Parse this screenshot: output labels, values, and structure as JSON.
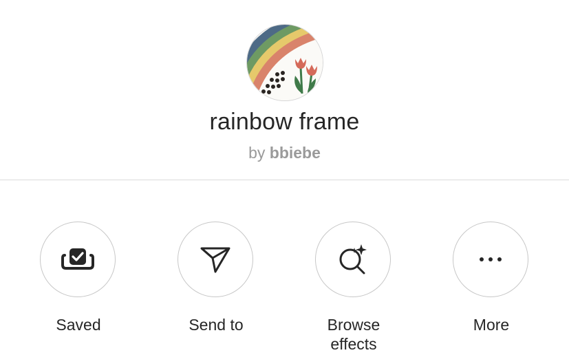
{
  "effect": {
    "name": "rainbow frame",
    "by_prefix": "by",
    "author": "bbiebe",
    "thumbnail_icon": "rainbow-tulip-thumbnail"
  },
  "actions": [
    {
      "label": "Saved",
      "icon": "saved-check-icon"
    },
    {
      "label": "Send to",
      "icon": "paper-plane-icon"
    },
    {
      "label": "Browse effects",
      "icon": "sparkle-search-icon"
    },
    {
      "label": "More",
      "icon": "more-dots-icon"
    }
  ],
  "colors": {
    "text_primary": "#262626",
    "text_secondary": "#9a9a9a",
    "divider": "#dbdbdb",
    "circle_border": "#c7c7c7"
  }
}
